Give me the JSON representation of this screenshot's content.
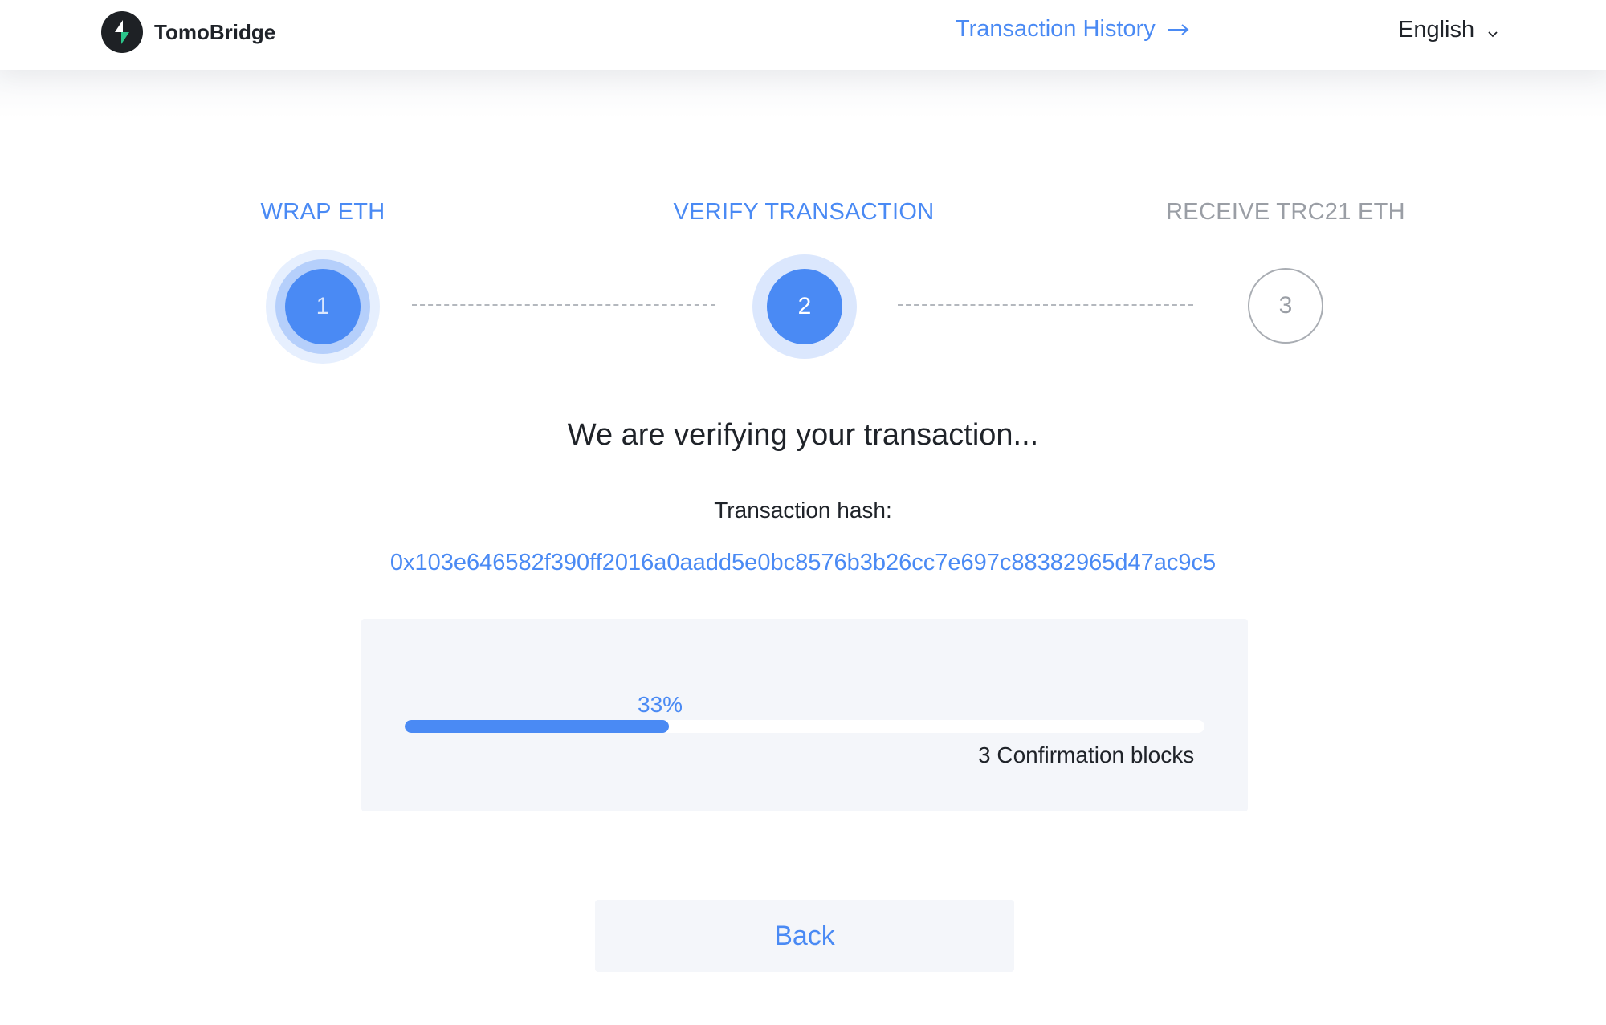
{
  "header": {
    "brand_name": "TomoBridge",
    "history_link": "Transaction History",
    "history_arrow": "→",
    "language": "English",
    "language_chevron": "v"
  },
  "steps": [
    {
      "label": "WRAP ETH",
      "number": "1",
      "state": "done"
    },
    {
      "label": "VERIFY TRANSACTION",
      "number": "2",
      "state": "active"
    },
    {
      "label": "RECEIVE TRC21 ETH",
      "number": "3",
      "state": "pending"
    }
  ],
  "main": {
    "headline": "We are verifying your transaction...",
    "hash_label": "Transaction hash:",
    "hash_value": "0x103e646582f390ff2016a0aadd5e0bc8576b3b26cc7e697c88382965d47ac9c5",
    "progress_percent_text": "33%",
    "progress_fraction": 0.33,
    "confirmations_text": "3 Confirmation blocks",
    "back_label": "Back"
  },
  "colors": {
    "accent": "#4a8af4",
    "muted": "#9a9ea5",
    "text": "#1f2329",
    "panel_bg": "#f4f6fa",
    "logo_bg": "#1e2125",
    "logo_mark_green": "#2bc48a"
  },
  "icons": {
    "logo": "tomobridge-logo-icon",
    "history_arrow": "arrow-right-icon",
    "language_chevron": "chevron-down-icon"
  }
}
